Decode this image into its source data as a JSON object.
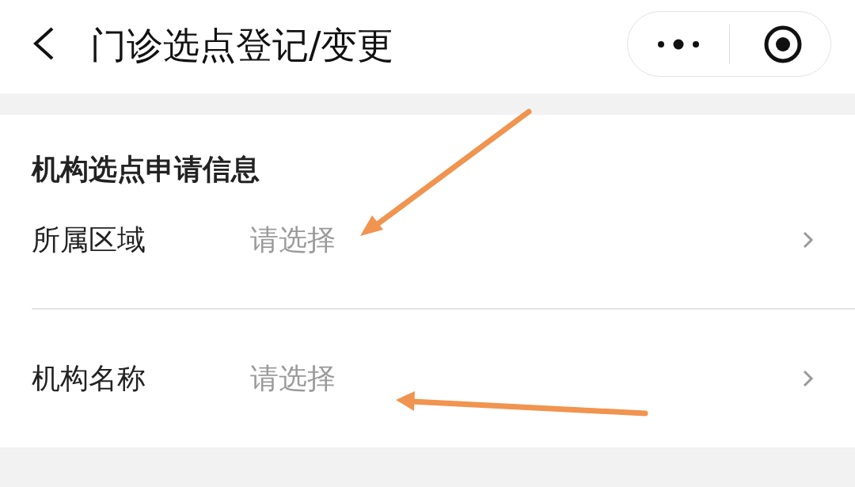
{
  "nav_bar": {
    "title": "门诊选点登记/变更"
  },
  "section": {
    "title": "机构选点申请信息",
    "rows": [
      {
        "label": "所属区域",
        "placeholder": "请选择"
      },
      {
        "label": "机构名称",
        "placeholder": "请选择"
      }
    ]
  }
}
